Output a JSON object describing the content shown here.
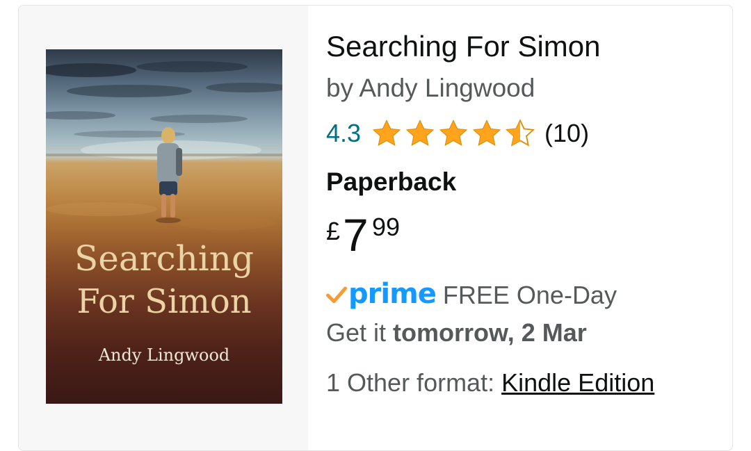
{
  "product": {
    "title": "Searching For Simon",
    "byline": "by Andy Lingwood",
    "rating": {
      "value": "4.3",
      "stars": 4.5,
      "count": "(10)",
      "star_color": "#ffa41c"
    },
    "format": "Paperback",
    "price": {
      "symbol": "£",
      "whole": "7",
      "fraction": "99"
    },
    "delivery": {
      "prime_label": "prime",
      "type": "FREE One-Day",
      "prefix": "Get it",
      "date": "tomorrow, 2 Mar"
    },
    "other_formats": {
      "label": "1 Other format:",
      "link": "Kindle Edition"
    }
  },
  "cover": {
    "title_line1": "Searching",
    "title_line2": "For Simon",
    "author": "Andy Lingwood"
  },
  "colors": {
    "rating_link": "#007185",
    "prime_blue": "#1399ff",
    "prime_check": "#f79c34",
    "text_primary": "#0f1111",
    "text_secondary": "#565959"
  }
}
